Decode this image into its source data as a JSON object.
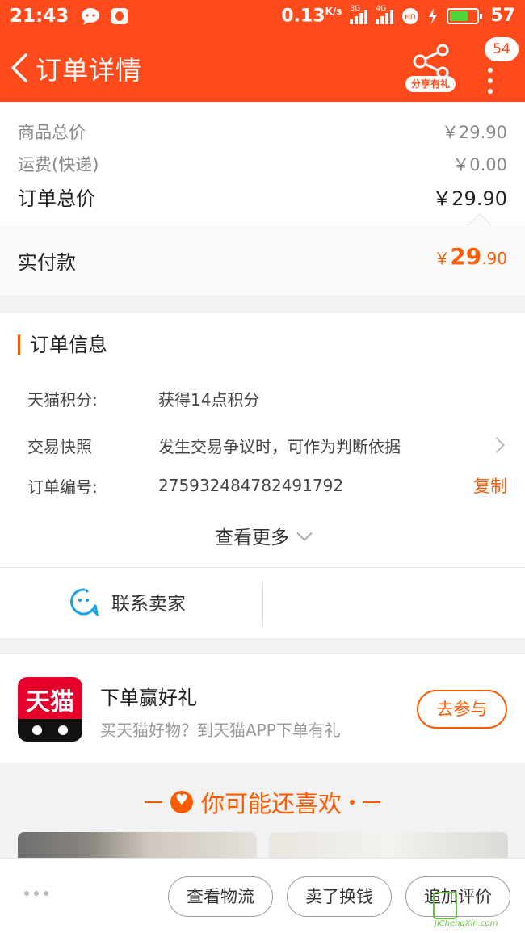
{
  "status_bar": {
    "time": "21:43",
    "net_speed": "0.13",
    "net_unit": "K/s",
    "signal1_tag": "3G",
    "signal2_tag": "4G",
    "battery": "57",
    "hd_label": "HD"
  },
  "header": {
    "title": "订单详情",
    "share_label": "分享有礼",
    "badge_count": "54"
  },
  "price": {
    "goods_label": "商品总价",
    "goods_value": "￥29.90",
    "shipping_label": "运费(快递)",
    "shipping_value": "￥0.00",
    "total_label": "订单总价",
    "total_value": "￥29.90",
    "paid_label": "实付款",
    "paid_currency": "￥",
    "paid_int": "29",
    "paid_dec": ".90"
  },
  "order_info": {
    "title": "订单信息",
    "rows": [
      {
        "key": "天猫积分:",
        "value": "获得14点积分"
      },
      {
        "key": "交易快照",
        "value": "发生交易争议时，可作为判断依据"
      },
      {
        "key": "订单编号:",
        "value": "2759324847824917​92"
      }
    ],
    "copy_label": "复制",
    "view_more": "查看更多"
  },
  "contact": {
    "label": "联系卖家"
  },
  "promo": {
    "logo_text": "天猫",
    "title": "下单赢好礼",
    "subtitle": "买天猫好物？到天猫APP下单有礼",
    "join_label": "去参与"
  },
  "recommend": {
    "title": "你可能还喜欢"
  },
  "bottom": {
    "buttons": [
      "查看物流",
      "卖了换钱",
      "追加评价"
    ]
  },
  "watermark": {
    "text": "JiChengXin.com"
  },
  "colors": {
    "brand": "#ff4a1c",
    "accent": "#ff5a00"
  }
}
